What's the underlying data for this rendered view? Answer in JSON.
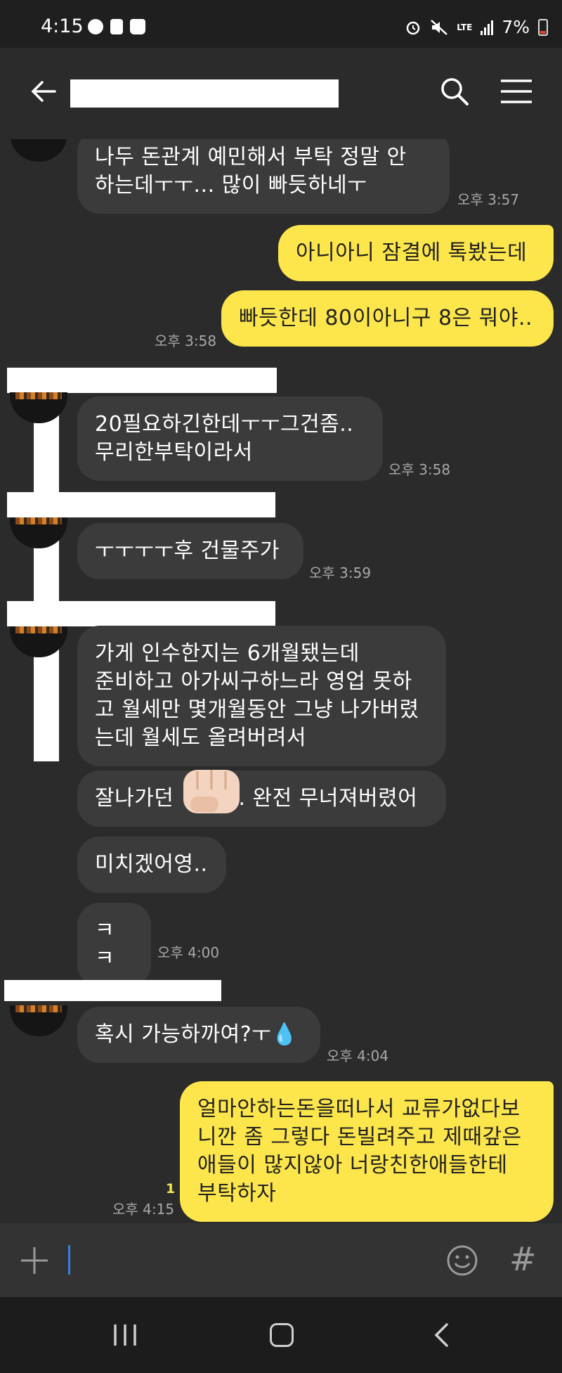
{
  "status": {
    "time": "4:15",
    "lte": "LTE",
    "battery": "7%"
  },
  "header": {
    "title_redacted": true
  },
  "messages": [
    {
      "side": "in",
      "text_line1": "나두 돈관계 예민해서 부탁 정말 안",
      "text_line2": "하는데ㅜㅜ... 많이 빠듯하네ㅜ",
      "time": "오후 3:57"
    },
    {
      "side": "out",
      "text": "아니아니 잠결에 톡봤는데"
    },
    {
      "side": "out",
      "text": "빠듯한데 80이아니구 8은 뭐야..",
      "time": "오후 3:58"
    },
    {
      "side": "in",
      "text_line1": "20필요하긴한데ㅜㅜ그건좀..",
      "text_line2": "무리한부탁이라서",
      "time": "오후 3:58"
    },
    {
      "side": "in",
      "text": "ㅜㅜㅜㅜ후 건물주가",
      "time": "오후 3:59"
    },
    {
      "side": "in",
      "text_line1": "가게 인수한지는 6개월됐는데",
      "text_line2": "준비하고 아가씨구하느라 영업 못하",
      "text_line3": "고 월세만 몇개월동안 그냥 나가버렸",
      "text_line4": "는데 월세도 올려버려서"
    },
    {
      "side": "in",
      "text_a": "잘나가던",
      "text_b": ".. 완전 무너져버렸어"
    },
    {
      "side": "in",
      "text": "미치겠어영.."
    },
    {
      "side": "in",
      "text": "ㅋㅋ",
      "time": "오후 4:00"
    },
    {
      "side": "in",
      "text": "혹시 가능하까여?ㅜ💧",
      "time": "오후 4:04"
    },
    {
      "side": "out",
      "text_line1": "얼마안하는돈을떠나서 교류가없다보",
      "text_line2": "니깐 좀 그렇다 돈빌려주고 제때갚은",
      "text_line3": "애들이 많지않아 너랑친한애들한테",
      "text_line4": "부탁하자",
      "time": "오후 4:15",
      "unread": "1"
    }
  ],
  "input": {
    "placeholder": ""
  },
  "colors": {
    "background": "#2b2b2b",
    "incoming_bubble": "#3b3b3b",
    "outgoing_bubble": "#fce64b",
    "timestamp": "#a9a9a9"
  },
  "icons": [
    "back-arrow-icon",
    "search-icon",
    "menu-icon",
    "plus-icon",
    "emoji-icon",
    "hash-icon",
    "recent-apps-icon",
    "home-icon",
    "nav-back-icon"
  ]
}
